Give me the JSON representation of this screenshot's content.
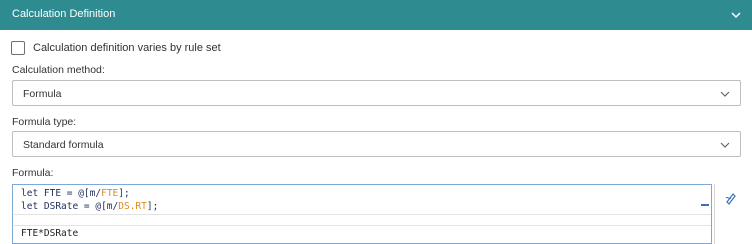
{
  "header": {
    "title": "Calculation Definition"
  },
  "varies_checkbox": {
    "label": "Calculation definition varies by rule set",
    "checked": false
  },
  "calculation_method": {
    "label": "Calculation method:",
    "value": "Formula"
  },
  "formula_type": {
    "label": "Formula type:",
    "value": "Standard formula"
  },
  "formula": {
    "label": "Formula:",
    "line1": {
      "kw": "let",
      "name": " FTE = @[m/",
      "var": "FTE",
      "end": "];"
    },
    "line2": {
      "kw": "let",
      "name": " DSRate = @[m/",
      "var": "DS.RT",
      "end": "];"
    },
    "line4": "FTE*DSRate"
  },
  "icons": {
    "header": "chevron-down-icon",
    "select": "chevron-down-icon",
    "editor_tool": "pen-icon"
  },
  "colors": {
    "header_bg": "#2e8b90",
    "variable": "#e08a1e",
    "code": "#1f2f5c",
    "editor_border": "#7ea8d8"
  }
}
